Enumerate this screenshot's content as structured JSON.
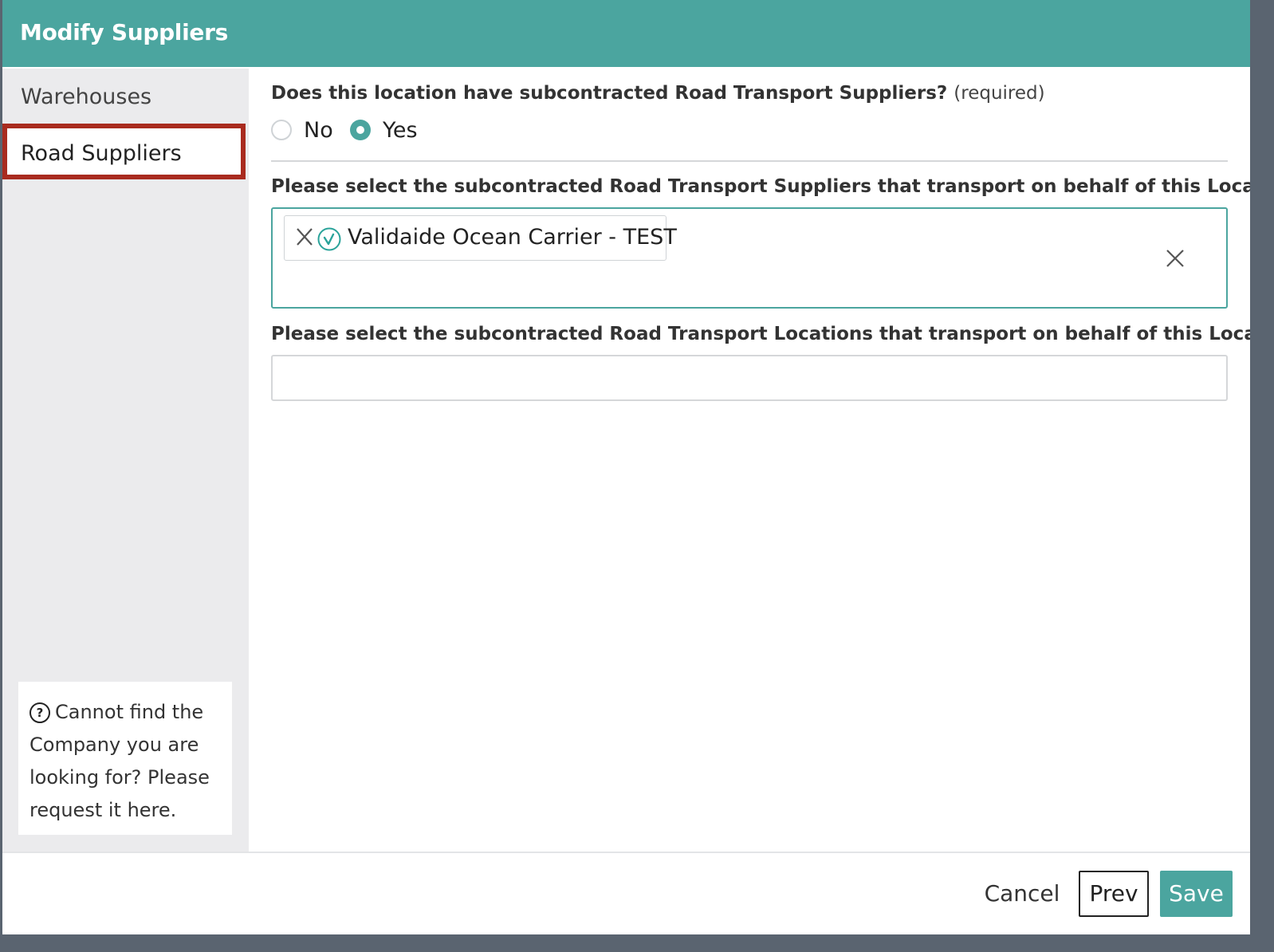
{
  "modal": {
    "title": "Modify Suppliers"
  },
  "sidebar": {
    "items": [
      {
        "label": "Warehouses"
      },
      {
        "label": "Road Suppliers"
      }
    ],
    "help_text": "Cannot find the Company you are looking for? Please request it here."
  },
  "question": {
    "label": "Does this location have subcontracted Road Transport Suppliers?",
    "required_note": "(required)",
    "options": [
      "No",
      "Yes"
    ],
    "selected": "Yes"
  },
  "suppliers_select": {
    "label": "Please select the subcontracted Road Transport Suppliers that transport on behalf of this Location.",
    "selected_chips": [
      {
        "label": "Validaide Ocean Carrier - TEST",
        "icon": "verified-check-icon"
      }
    ]
  },
  "locations_select": {
    "label": "Please select the subcontracted Road Transport Locations that transport on behalf of this Location.",
    "value": ""
  },
  "footer": {
    "cancel_label": "Cancel",
    "prev_label": "Prev",
    "save_label": "Save"
  },
  "colors": {
    "accent": "#4ba59f",
    "active_outline": "#a92b1f"
  }
}
